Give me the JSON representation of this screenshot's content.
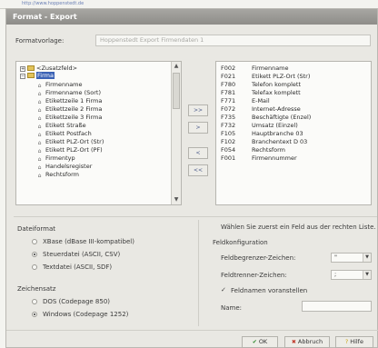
{
  "background": {
    "url_text": "http://www.hoppenstedt.de"
  },
  "dialog": {
    "title": "Format - Export",
    "template_label": "Formatvorlage:",
    "template_value": "Hoppenstedt Export Firmendaten 1"
  },
  "tree": {
    "items": [
      {
        "label": "<Zusatzfeld>",
        "kind": "folder",
        "level": 0
      },
      {
        "label": "Firma",
        "kind": "folder-open",
        "level": 0,
        "selected": true
      },
      {
        "label": "Firmenname",
        "kind": "leaf",
        "level": 1
      },
      {
        "label": "Firmenname (Sort)",
        "kind": "leaf",
        "level": 1
      },
      {
        "label": "Etikettzeile 1 Firma",
        "kind": "leaf",
        "level": 1
      },
      {
        "label": "Etikettzeile 2 Firma",
        "kind": "leaf",
        "level": 1
      },
      {
        "label": "Etikettzeile 3 Firma",
        "kind": "leaf",
        "level": 1
      },
      {
        "label": "Etikett Straße",
        "kind": "leaf",
        "level": 1
      },
      {
        "label": "Etikett Postfach",
        "kind": "leaf",
        "level": 1
      },
      {
        "label": "Etikett PLZ-Ort (Str)",
        "kind": "leaf",
        "level": 1
      },
      {
        "label": "Etikett PLZ-Ort (PF)",
        "kind": "leaf",
        "level": 1
      },
      {
        "label": "Firmentyp",
        "kind": "leaf",
        "level": 1
      },
      {
        "label": "Handelsregister",
        "kind": "leaf",
        "level": 1
      },
      {
        "label": "Rechtsform",
        "kind": "leaf",
        "level": 1
      }
    ]
  },
  "move_buttons": [
    ">>",
    ">",
    "<",
    "<<"
  ],
  "fields": [
    {
      "code": "F002",
      "name": "Firmenname"
    },
    {
      "code": "F021",
      "name": "Etikett PLZ-Ort (Str)"
    },
    {
      "code": "F780",
      "name": "Telefon komplett"
    },
    {
      "code": "F781",
      "name": "Telefax komplett"
    },
    {
      "code": "F771",
      "name": "E-Mail"
    },
    {
      "code": "F072",
      "name": "Internet-Adresse"
    },
    {
      "code": "F735",
      "name": "Beschäftigte (Enzel)"
    },
    {
      "code": "F732",
      "name": "Umsatz (Einzel)"
    },
    {
      "code": "F105",
      "name": "Hauptbranche 03"
    },
    {
      "code": "F102",
      "name": "Branchentext D 03"
    },
    {
      "code": "F054",
      "name": "Rechtsform"
    },
    {
      "code": "F001",
      "name": "Firmennummer"
    }
  ],
  "dateiformat": {
    "label": "Dateiformat",
    "options": [
      {
        "label": "XBase (dBase III-kompatibel)",
        "checked": false
      },
      {
        "label": "Steuerdatei (ASCII, CSV)",
        "checked": true
      },
      {
        "label": "Textdatei (ASCII, SDF)",
        "checked": false
      }
    ]
  },
  "zeichensatz": {
    "label": "Zeichensatz",
    "options": [
      {
        "label": "DOS (Codepage 850)",
        "checked": false
      },
      {
        "label": "Windows (Codepage 1252)",
        "checked": true
      }
    ]
  },
  "hint": "Wählen Sie zuerst ein Feld aus der rechten Liste.",
  "feldkonfiguration": {
    "label": "Feldkonfiguration",
    "begrenzer_label": "Feldbegrenzer-Zeichen:",
    "begrenzer_value": "\"",
    "trenner_label": "Feldtrenner-Zeichen:",
    "trenner_value": ";",
    "names_label": "Feldnamen voranstellen",
    "name_label": "Name:"
  },
  "buttons": {
    "ok": "OK",
    "cancel": "Abbruch",
    "help": "Hilfe"
  }
}
